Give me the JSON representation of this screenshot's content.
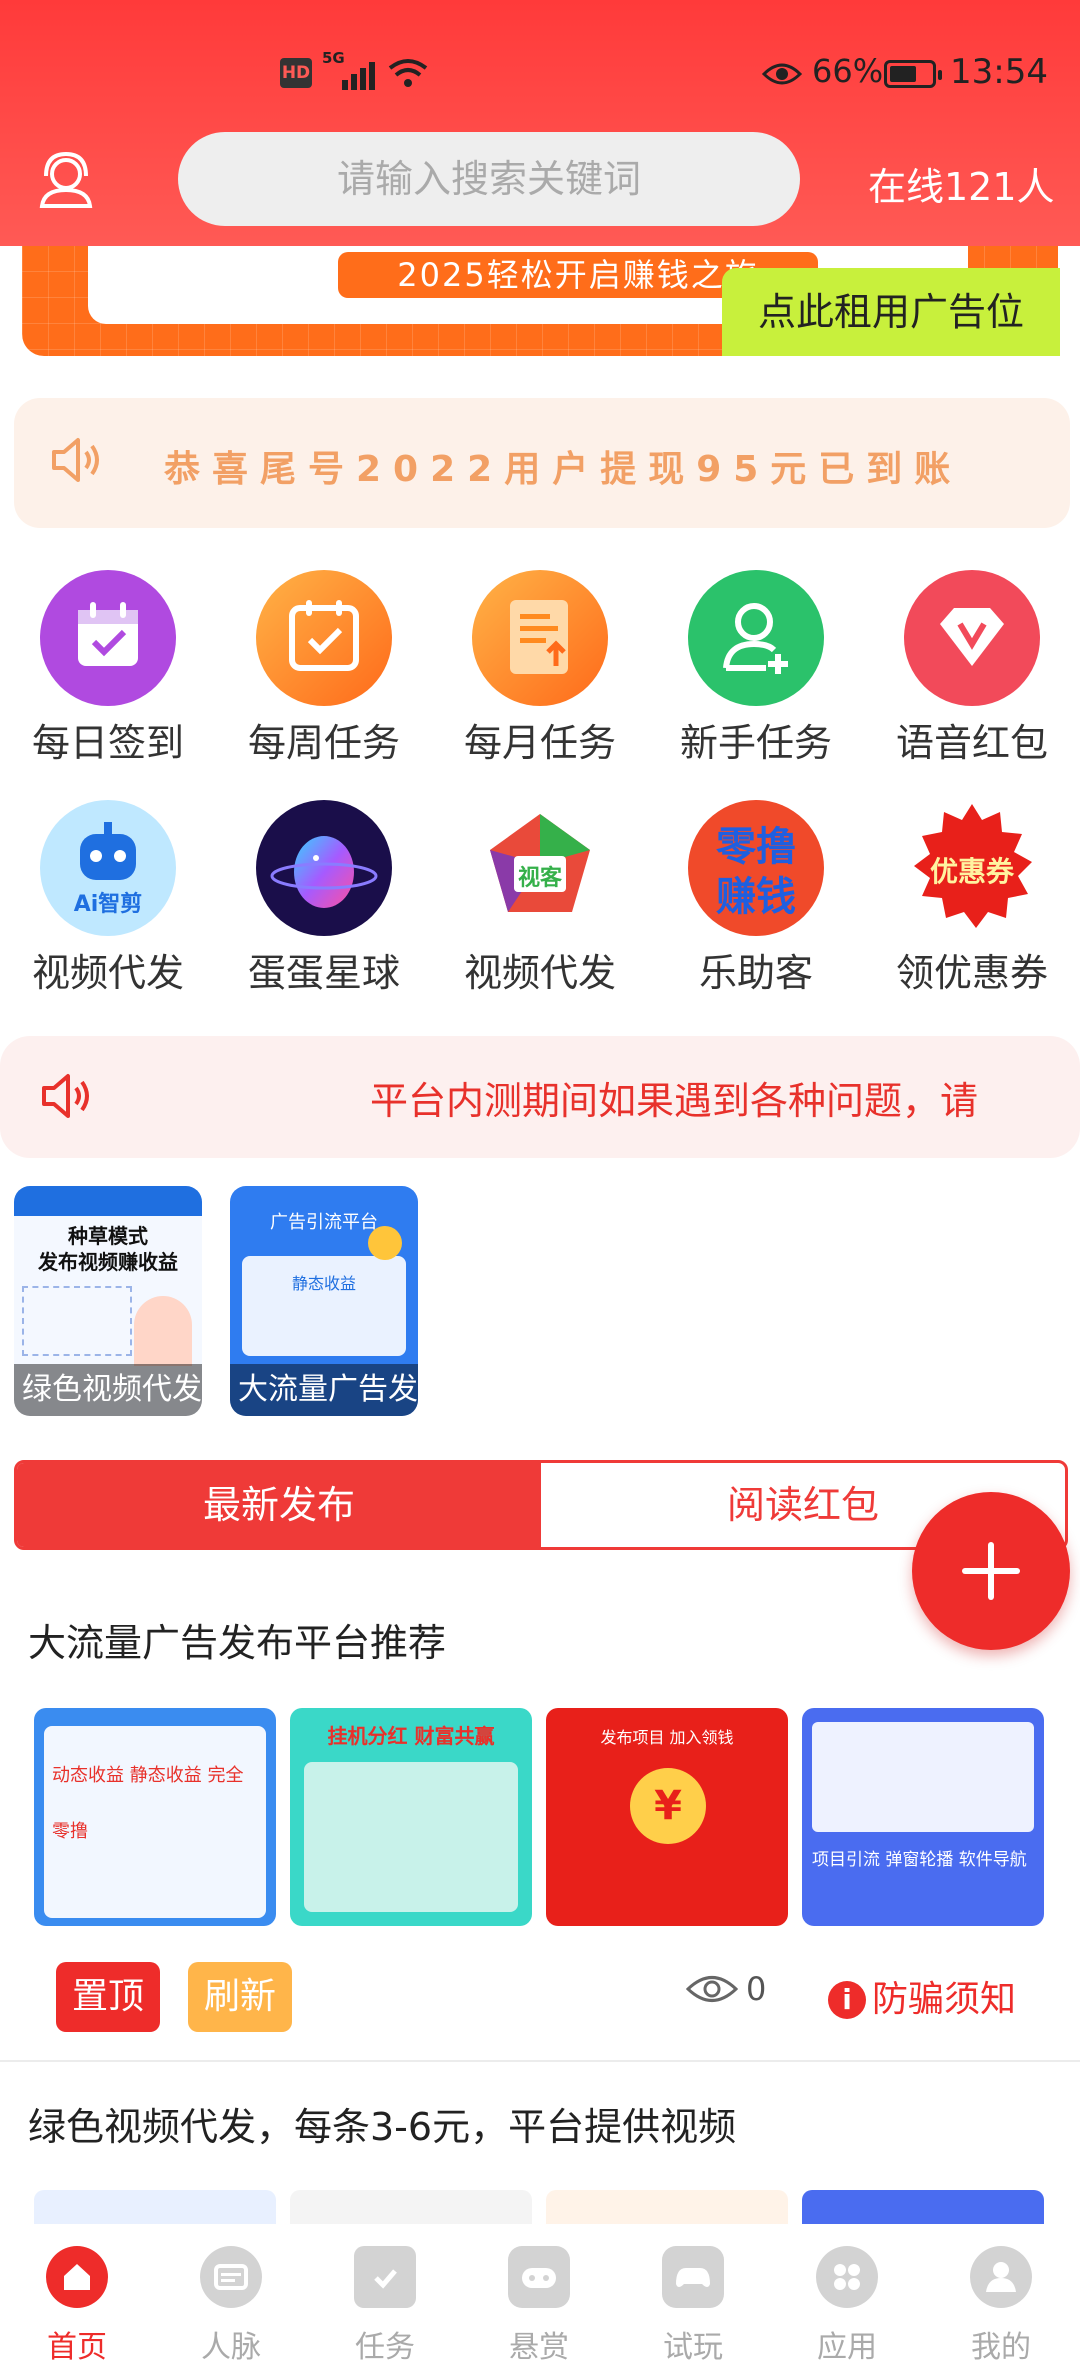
{
  "status_bar": {
    "network": "5G",
    "hd": "HD",
    "battery_pct": "66%",
    "battery_level": 0.66,
    "time": "13:54"
  },
  "header": {
    "search_placeholder": "请输入搜索关键词",
    "online": "在线121人"
  },
  "banner": {
    "slogan": "2025轻松开启赚钱之旅",
    "rent_ad": "点此租用广告位"
  },
  "notice_top": "恭喜尾号2022用户提现95元已到账",
  "grid": [
    {
      "label": "每日签到",
      "icon": "calendar-check-icon",
      "color": "#b04ae0"
    },
    {
      "label": "每周任务",
      "icon": "calendar-check-icon",
      "color": "#ff8a1f"
    },
    {
      "label": "每月任务",
      "icon": "document-upload-icon",
      "color": "#ff8a1f"
    },
    {
      "label": "新手任务",
      "icon": "add-user-icon",
      "color": "#2bc26b"
    },
    {
      "label": "语音红包",
      "icon": "diamond-v-icon",
      "color": "#f24a5a"
    },
    {
      "label": "视频代发",
      "icon": "ai-robot-icon",
      "color": "#3aa8f0"
    },
    {
      "label": "蛋蛋星球",
      "icon": "planet-egg-icon",
      "color": "#2a1a6e"
    },
    {
      "label": "视频代发",
      "icon": "pentagon-logo-icon",
      "color": "#e94a3a"
    },
    {
      "label": "乐助客",
      "icon": "zero-earn-icon",
      "color": "#f04a2a"
    },
    {
      "label": "领优惠券",
      "icon": "coupon-badge-icon",
      "color": "#e8201a"
    }
  ],
  "grid_icon_text": {
    "ai": "Ai智剪",
    "shike": "视客",
    "zero": "零撸",
    "earn": "赚钱",
    "coupon": "优惠券"
  },
  "notice_scroll": "平台内测期间如果遇到各种问题，请",
  "thumbs": [
    {
      "caption": "绿色视频代发",
      "heading": "种草模式",
      "sub": "发布视频赚收益"
    },
    {
      "caption": "大流量广告发布",
      "heading": "广告引流平台",
      "sub": "静态收益"
    }
  ],
  "tabs": {
    "active": "最新发布",
    "other": "阅读红包"
  },
  "post1": {
    "title": "大流量广告发布平台推荐",
    "images": [
      {
        "text": "动态收益 静态收益 完全零撸"
      },
      {
        "text": "挂机分红 财富共赢"
      },
      {
        "text": "发布项目 加入领钱"
      },
      {
        "text": "项目引流 弹窗轮播 软件导航"
      }
    ],
    "pin": "置顶",
    "refresh": "刷新",
    "views": "0",
    "fraud": "防骗须知"
  },
  "post2": {
    "title": "绿色视频代发，每条3-6元，平台提供视频"
  },
  "bottom_nav": [
    {
      "label": "首页",
      "icon": "home-icon",
      "active": true
    },
    {
      "label": "人脉",
      "icon": "card-icon",
      "active": false
    },
    {
      "label": "任务",
      "icon": "task-icon",
      "active": false
    },
    {
      "label": "悬赏",
      "icon": "gamepad-icon",
      "active": false
    },
    {
      "label": "试玩",
      "icon": "controller-icon",
      "active": false
    },
    {
      "label": "应用",
      "icon": "apps-icon",
      "active": false
    },
    {
      "label": "我的",
      "icon": "user-icon",
      "active": false
    }
  ]
}
